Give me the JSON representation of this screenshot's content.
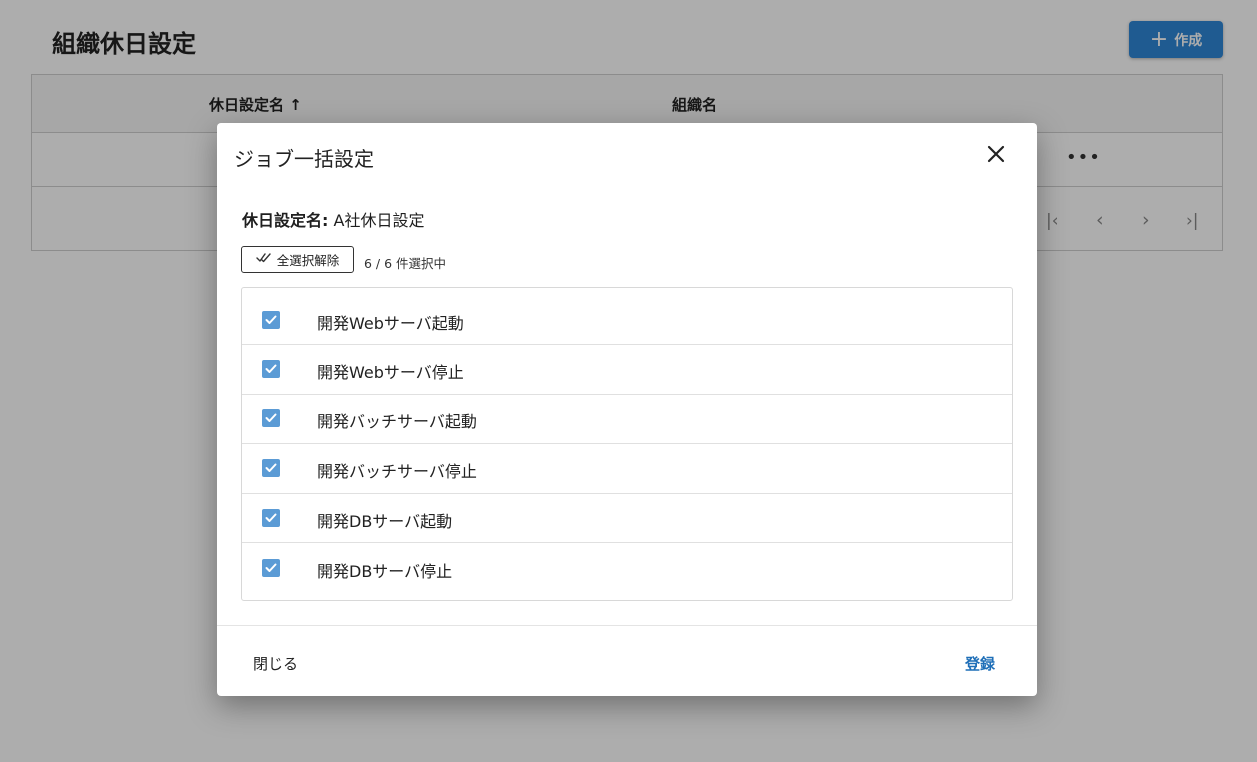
{
  "page": {
    "title": "組織休日設定",
    "create_label": "作成",
    "table": {
      "columns": [
        "休日設定名",
        "組織名"
      ],
      "sort_indicator": "↑"
    },
    "pager_icons": [
      "first-page-icon",
      "prev-page-icon",
      "next-page-icon",
      "last-page-icon"
    ]
  },
  "dialog": {
    "title": "ジョブ一括設定",
    "holiday_label": "休日設定名:",
    "holiday_value": "A社休日設定",
    "toggle_label": "全選択解除",
    "count_text": "6 / 6 件選択中",
    "jobs": [
      {
        "name": "開発Webサーバ起動",
        "checked": true
      },
      {
        "name": "開発Webサーバ停止",
        "checked": true
      },
      {
        "name": "開発バッチサーバ起動",
        "checked": true
      },
      {
        "name": "開発バッチサーバ停止",
        "checked": true
      },
      {
        "name": "開発DBサーバ起動",
        "checked": true
      },
      {
        "name": "開発DBサーバ停止",
        "checked": true
      }
    ],
    "close_label": "閉じる",
    "register_label": "登録"
  },
  "colors": {
    "primary": "#2f86d6",
    "checkbox": "#5b9bd5",
    "link": "#1f6fb8"
  }
}
